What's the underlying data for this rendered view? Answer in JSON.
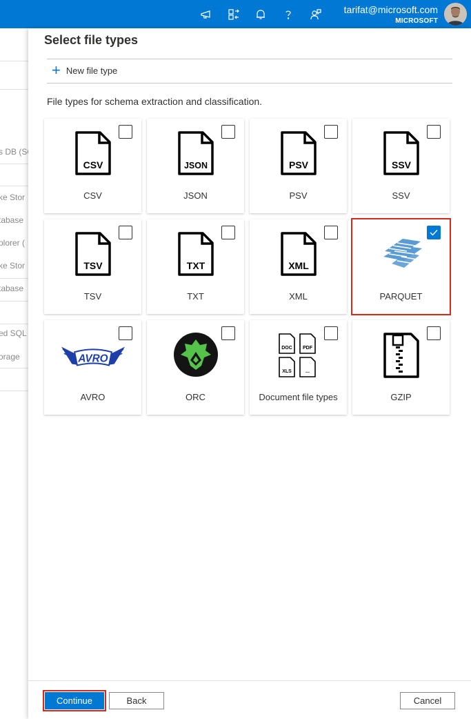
{
  "topbar": {
    "icons": [
      "megaphone-icon",
      "directory-switch-icon",
      "bell-icon",
      "help-icon",
      "feedback-icon"
    ],
    "account_email": "tarifat@microsoft.com",
    "account_org": "MICROSOFT"
  },
  "background_list": {
    "items": [
      "s DB (SC",
      "ke Stor",
      "tabase",
      "plorer (",
      "ke Stor",
      "tabase",
      "ed SQL",
      "orage"
    ]
  },
  "blade": {
    "title": "Select file types",
    "new_file_type_label": "New file type",
    "description": "File types for schema extraction and classification.",
    "tiles": [
      {
        "label": "CSV",
        "badge": "CSV",
        "icon": "csv-file-icon",
        "checked": false
      },
      {
        "label": "JSON",
        "badge": "JSON",
        "icon": "json-file-icon",
        "checked": false
      },
      {
        "label": "PSV",
        "badge": "PSV",
        "icon": "psv-file-icon",
        "checked": false
      },
      {
        "label": "SSV",
        "badge": "SSV",
        "icon": "ssv-file-icon",
        "checked": false
      },
      {
        "label": "TSV",
        "badge": "TSV",
        "icon": "tsv-file-icon",
        "checked": false
      },
      {
        "label": "TXT",
        "badge": "TXT",
        "icon": "txt-file-icon",
        "checked": false
      },
      {
        "label": "XML",
        "badge": "XML",
        "icon": "xml-file-icon",
        "checked": false
      },
      {
        "label": "PARQUET",
        "icon": "parquet-logo-icon",
        "checked": true
      },
      {
        "label": "AVRO",
        "logo_text": "AVRO",
        "icon": "avro-logo-icon",
        "checked": false
      },
      {
        "label": "ORC",
        "icon": "orc-logo-icon",
        "checked": false
      },
      {
        "label": "Document file types",
        "doc_badges": [
          "DOC",
          "PDF",
          "XLS",
          "..."
        ],
        "icon": "document-files-icon",
        "checked": false
      },
      {
        "label": "GZIP",
        "icon": "zip-file-icon",
        "checked": false
      }
    ]
  },
  "footer": {
    "continue_label": "Continue",
    "back_label": "Back",
    "cancel_label": "Cancel"
  },
  "colors": {
    "accent": "#0078d4",
    "highlight": "#d8281b"
  }
}
